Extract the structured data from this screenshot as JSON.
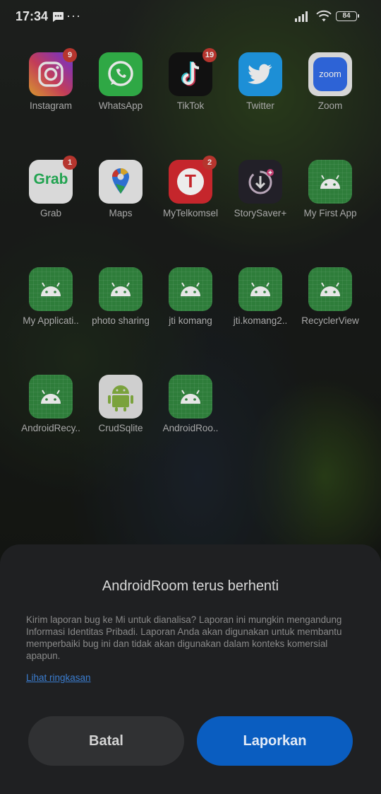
{
  "status_bar": {
    "time": "17:34",
    "dots": "···",
    "battery": "84"
  },
  "apps": [
    {
      "label": "Instagram",
      "badge": "9",
      "icon": "instagram-icon"
    },
    {
      "label": "WhatsApp",
      "badge": "",
      "icon": "whatsapp-icon"
    },
    {
      "label": "TikTok",
      "badge": "19",
      "icon": "tiktok-icon"
    },
    {
      "label": "Twitter",
      "badge": "",
      "icon": "twitter-icon"
    },
    {
      "label": "Zoom",
      "badge": "",
      "icon": "zoom-icon",
      "icon_text": "zoom"
    },
    {
      "label": "Grab",
      "badge": "1",
      "icon": "grab-icon",
      "icon_text": "Grab"
    },
    {
      "label": "Maps",
      "badge": "",
      "icon": "maps-icon"
    },
    {
      "label": "MyTelkomsel",
      "badge": "2",
      "icon": "telkomsel-icon",
      "icon_text": "T"
    },
    {
      "label": "StorySaver+",
      "badge": "",
      "icon": "storysaver-icon"
    },
    {
      "label": "My First App",
      "badge": "",
      "icon": "android-icon"
    },
    {
      "label": "My Applicati..",
      "badge": "",
      "icon": "android-icon"
    },
    {
      "label": "photo sharing",
      "badge": "",
      "icon": "android-icon"
    },
    {
      "label": "jti komang",
      "badge": "",
      "icon": "android-icon"
    },
    {
      "label": "jti.komang2..",
      "badge": "",
      "icon": "android-icon"
    },
    {
      "label": "RecyclerView",
      "badge": "",
      "icon": "android-icon"
    },
    {
      "label": "AndroidRecy..",
      "badge": "",
      "icon": "android-icon"
    },
    {
      "label": "CrudSqlite",
      "badge": "",
      "icon": "android-icon"
    },
    {
      "label": "AndroidRoo..",
      "badge": "",
      "icon": "android-icon"
    }
  ],
  "dialog": {
    "title": "AndroidRoom terus berhenti",
    "body": "Kirim laporan bug ke Mi untuk dianalisa? Laporan ini mungkin mengandung Informasi Identitas Pribadi. Laporan Anda akan digunakan untuk membantu memperbaiki bug ini dan tidak akan digunakan dalam konteks komersial apapun.",
    "link": "Lihat ringkasan",
    "cancel_label": "Batal",
    "report_label": "Laporkan"
  },
  "colors": {
    "report_button": "#0a5dc0",
    "link": "#3b7dd0",
    "badge": "#b6352e"
  }
}
